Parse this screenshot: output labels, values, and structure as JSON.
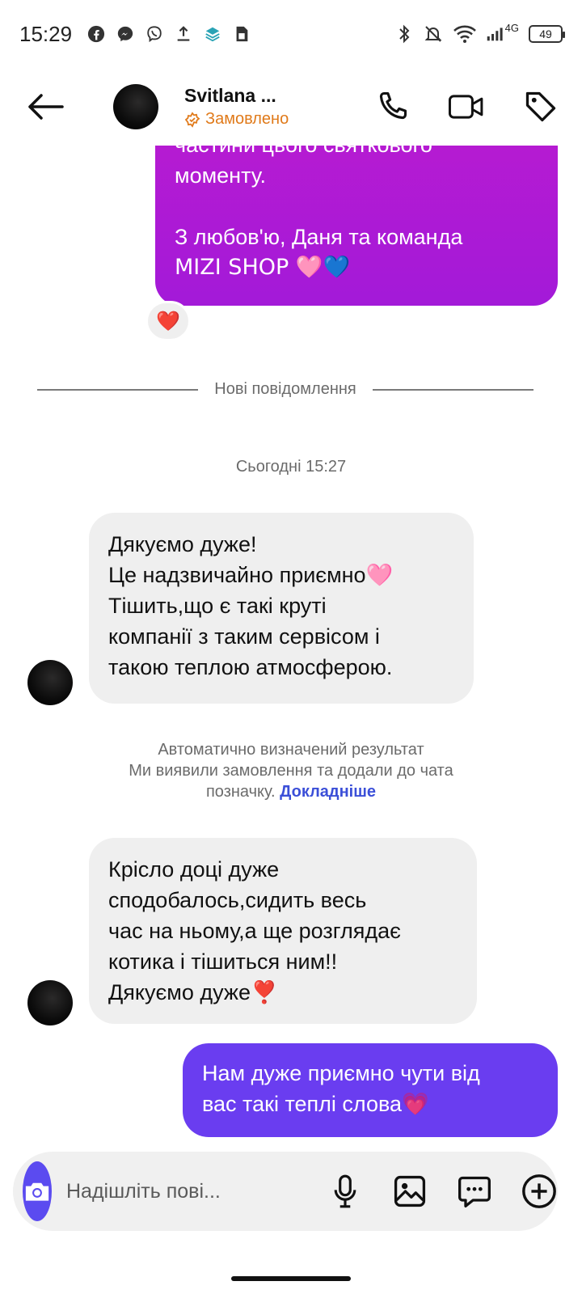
{
  "status_bar": {
    "time": "15:29",
    "network": "4G",
    "battery": "49"
  },
  "header": {
    "name": "Svitlana ...",
    "status": "Замовлено"
  },
  "messages": {
    "outgoing_1": {
      "lines": [
        "частини цього святкового",
        "моменту."
      ],
      "closing_lines": [
        "З любов'ю, Даня та команда",
        "MIZI SHOP 🩷💙"
      ]
    },
    "reaction": "❤️",
    "divider_label": "Нові повідомлення",
    "timestamp": "Сьогодні 15:27",
    "incoming_1": {
      "lines": [
        "Дякуємо дуже!",
        "Це надзвичайно приємно🩷",
        "Тішить,що є такі круті",
        "компанії з таким сервісом і",
        "такою теплою атмосферою."
      ]
    },
    "system_note": {
      "line1": "Автоматично визначений результат",
      "line2": "Ми виявили замовлення та додали до чата",
      "line3": "позначку.",
      "link": "Докладніше"
    },
    "incoming_2": {
      "lines": [
        "Крісло доці дуже",
        "сподобалось,сидить весь",
        "час на ньому,а ще розглядає",
        "котика і тішиться ним!!",
        "Дякуємо дуже❣️"
      ]
    },
    "outgoing_2": {
      "lines": [
        "Нам дуже приємно чути від",
        "вас такі теплі слова💗"
      ]
    }
  },
  "composer": {
    "placeholder": "Надішліть пові..."
  },
  "icons": {
    "back": "arrow-left-icon",
    "call": "phone-icon",
    "video": "video-camera-icon",
    "tag": "tag-icon",
    "camera": "camera-icon",
    "mic": "microphone-icon",
    "gallery": "image-icon",
    "sticker": "chat-bubble-icon",
    "more": "plus-circle-icon"
  },
  "colors": {
    "outgoing_purple": "#b81bd1",
    "outgoing_blue": "#6a3df0",
    "incoming_bg": "#efefef",
    "status_orange": "#e07a1a",
    "link_blue": "#3b4fd8",
    "camera_button": "#5b4bf0"
  }
}
